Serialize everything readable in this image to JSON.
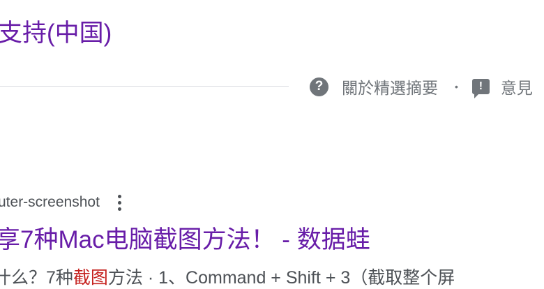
{
  "top_result": {
    "title_fragment": "支持(中国)"
  },
  "featured_snippet_footer": {
    "about_label": "關於精選摘要",
    "separator": "•",
    "feedback_label": "意見",
    "icons": [
      "help-circle-icon",
      "feedback-icon"
    ]
  },
  "result": {
    "url_fragment": "uter-screenshot",
    "title": "享7种Mac电脑截图方法！ - 数据蛙",
    "snippet": {
      "before": "什么？7种",
      "highlight": "截图",
      "after": "方法 · 1、Command + Shift + 3（截取整个屏"
    }
  },
  "colors": {
    "visited_link": "#681da8",
    "body_text": "#4d5156",
    "secondary_text": "#70757a",
    "highlight": "#c5221f",
    "divider": "#dadce0"
  }
}
